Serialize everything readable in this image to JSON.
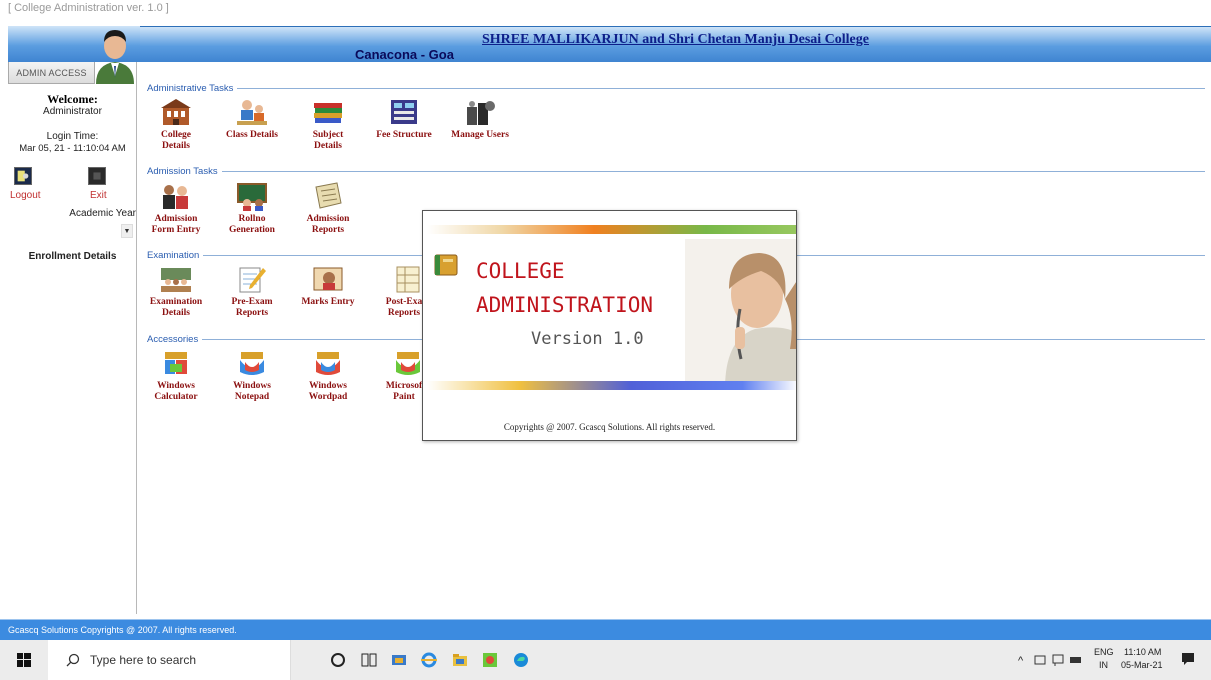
{
  "window": {
    "title": "[ College Administration ver. 1.0 ]"
  },
  "header": {
    "college_name": "SHREE MALLIKARJUN and Shri Chetan Manju Desai College",
    "location": "Canacona - Goa"
  },
  "sidebar": {
    "access_label": "ADMIN ACCESS",
    "welcome": "Welcome:",
    "user": "Administrator",
    "login_label": "Login Time:",
    "login_time": "Mar 05, 21 - 11:10:04 AM",
    "logout_label": "Logout",
    "exit_label": "Exit",
    "academic_year_label": "Academic Year",
    "enrollment_label": "Enrollment Details"
  },
  "sections": {
    "administrative": {
      "label": "Administrative Tasks",
      "items": [
        {
          "line1": "College",
          "line2": "Details"
        },
        {
          "line1": "Class Details",
          "line2": ""
        },
        {
          "line1": "Subject",
          "line2": "Details"
        },
        {
          "line1": "Fee Structure",
          "line2": ""
        },
        {
          "line1": "Manage Users",
          "line2": ""
        }
      ]
    },
    "admission": {
      "label": "Admission Tasks",
      "items": [
        {
          "line1": "Admission",
          "line2": "Form Entry"
        },
        {
          "line1": "Rollno",
          "line2": "Generation"
        },
        {
          "line1": "Admission",
          "line2": "Reports"
        }
      ]
    },
    "examination": {
      "label": "Examination",
      "items": [
        {
          "line1": "Examination",
          "line2": "Details"
        },
        {
          "line1": "Pre-Exam",
          "line2": "Reports"
        },
        {
          "line1": "Marks Entry",
          "line2": ""
        },
        {
          "line1": "Post-Exa",
          "line2": "Reports"
        }
      ]
    },
    "accessories": {
      "label": "Accessories",
      "items": [
        {
          "line1": "Windows",
          "line2": "Calculator"
        },
        {
          "line1": "Windows",
          "line2": "Notepad"
        },
        {
          "line1": "Windows",
          "line2": "Wordpad"
        },
        {
          "line1": "Microsof",
          "line2": "Paint"
        }
      ]
    }
  },
  "splash": {
    "line1": "COLLEGE",
    "line2": "ADMINISTRATION",
    "version": "Version 1.0",
    "copyright": "Copyrights @ 2007. Gcascq Solutions. All rights reserved."
  },
  "footer": {
    "text": "Gcascq Solutions Copyrights @ 2007. All rights reserved."
  },
  "taskbar": {
    "search_placeholder": "Type here to search",
    "lang": "ENG",
    "region": "IN",
    "time": "11:10 AM",
    "date": "05-Mar-21"
  }
}
